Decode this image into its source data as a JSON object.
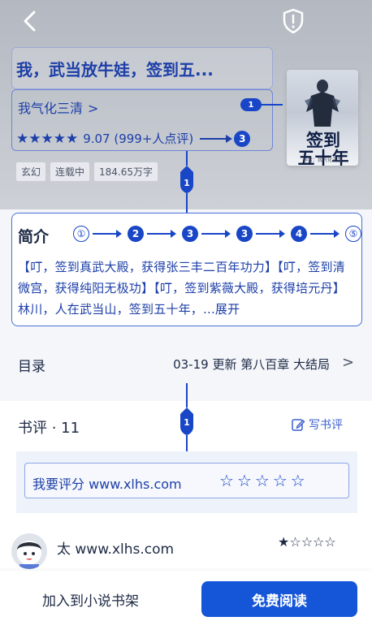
{
  "header": {
    "back_icon": "chevron-left-icon",
    "shield_icon": "shield-alert-icon"
  },
  "book": {
    "title": "我，武当放牛娃，签到五...",
    "author": "我气化三清",
    "author_chevron": ">",
    "author_marker": "1",
    "rating_stars": "★★★★★",
    "rating_value": 5,
    "score": "9.07 (999+人点评)",
    "score_marker": "3",
    "tags": [
      "玄幻",
      "连载中",
      "184.65万字"
    ],
    "cover": {
      "title_lines": [
        "签到",
        "五十年"
      ],
      "author_line": "作者：我气化三清"
    },
    "connector_marker": "1"
  },
  "intro": {
    "title": "简介",
    "steps": [
      {
        "label": "①",
        "style": "outline"
      },
      {
        "label": "2",
        "style": "filled"
      },
      {
        "label": "3",
        "style": "filled"
      },
      {
        "label": "3",
        "style": "filled"
      },
      {
        "label": "4",
        "style": "filled"
      },
      {
        "label": "⑤",
        "style": "outline"
      }
    ],
    "text": "【叮，签到真武大殿，获得张三丰二百年功力】【叮，签到清微宫，获得纯阳无极功】【叮，签到紫薇大殿，获得培元丹】林川，人在武当山，签到五十年，...",
    "expand_label": "展开"
  },
  "toc": {
    "label": "目录",
    "latest": "03-19 更新 第八百章 大结局",
    "chevron": ">"
  },
  "reviews": {
    "title": "书评 · 11",
    "marker": "1",
    "write_label": "写书评",
    "rate_label": "我要评分 www.xlhs.com",
    "rate_stars": [
      "☆",
      "☆",
      "☆",
      "☆",
      "☆"
    ],
    "comment": {
      "user": "太  www.xlhs.com",
      "stars": "★☆☆☆☆",
      "rating": 1
    }
  },
  "bottom": {
    "shelf_label": "加入到小说书架",
    "read_label": "免费阅读"
  },
  "colors": {
    "accent": "#1846c6",
    "primary_button": "#1556d8",
    "text_blue": "#1d3fa8"
  }
}
